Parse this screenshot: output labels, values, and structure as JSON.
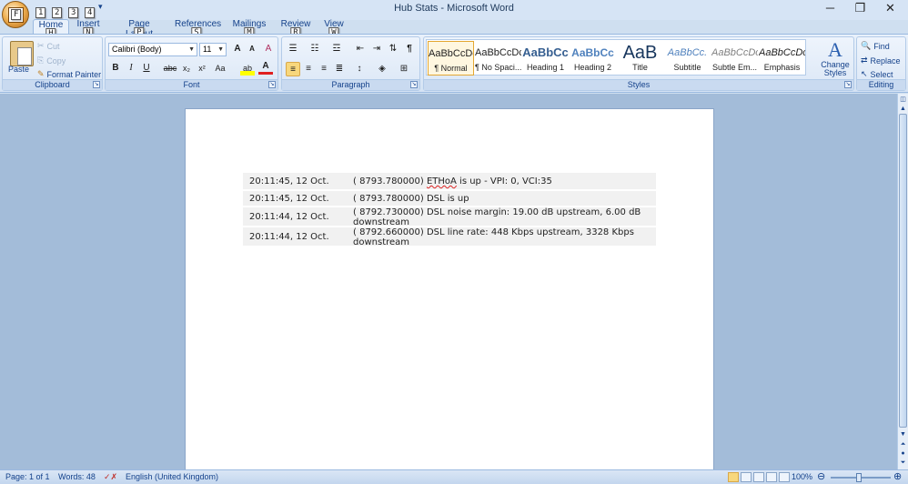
{
  "window": {
    "title": "Hub Stats - Microsoft Word",
    "minimize": "─",
    "restore": "❐",
    "close": "✕"
  },
  "office_button": {
    "glyph": "W",
    "keytip": "F"
  },
  "qat": [
    {
      "name": "save-icon",
      "keytip": "1"
    },
    {
      "name": "undo-icon",
      "keytip": "2"
    },
    {
      "name": "redo-icon",
      "keytip": "3"
    },
    {
      "name": "print-icon",
      "keytip": "4"
    }
  ],
  "qat_more": "▾",
  "tabs": [
    {
      "label": "Home",
      "keytip": "H",
      "active": true
    },
    {
      "label": "Insert",
      "keytip": "N"
    },
    {
      "label": "Page Layout",
      "keytip": "P"
    },
    {
      "label": "References",
      "keytip": "S"
    },
    {
      "label": "Mailings",
      "keytip": "M"
    },
    {
      "label": "Review",
      "keytip": "R"
    },
    {
      "label": "View",
      "keytip": "W"
    }
  ],
  "clipboard": {
    "paste": "Paste",
    "cut": "Cut",
    "copy": "Copy",
    "format_painter": "Format Painter",
    "label": "Clipboard"
  },
  "font": {
    "name": "Calibri (Body)",
    "size": "11",
    "label": "Font",
    "bold": "B",
    "italic": "I",
    "underline": "U",
    "strike": "abc",
    "subscript": "x₂",
    "superscript": "x²",
    "change_case": "Aa",
    "grow": "A",
    "shrink": "A",
    "clear": "A",
    "highlight": "ab",
    "font_color": "A"
  },
  "paragraph": {
    "label": "Paragraph",
    "show_marks": "¶"
  },
  "styles": {
    "label": "Styles",
    "items": [
      {
        "preview": "AaBbCcDc",
        "label": "¶ Normal",
        "selected": true
      },
      {
        "preview": "AaBbCcDc",
        "label": "¶ No Spaci..."
      },
      {
        "preview": "AaBbCc",
        "label": "Heading 1"
      },
      {
        "preview": "AaBbCc",
        "label": "Heading 2"
      },
      {
        "preview": "AaB",
        "label": "Title"
      },
      {
        "preview": "AaBbCc.",
        "label": "Subtitle"
      },
      {
        "preview": "AaBbCcDc",
        "label": "Subtle Em..."
      },
      {
        "preview": "AaBbCcDc",
        "label": "Emphasis"
      }
    ],
    "change_styles": "Change Styles"
  },
  "editing": {
    "find": "Find",
    "replace": "Replace",
    "select": "Select",
    "label": "Editing"
  },
  "document": {
    "rows": [
      {
        "time": "20:11:45, 12 Oct.",
        "prefix": "( 8793.780000) ",
        "flagged": "ETHoA",
        "message": " is up - VPI: 0, VCI:35"
      },
      {
        "time": "20:11:45, 12 Oct.",
        "prefix": "( 8793.780000) ",
        "flagged": "",
        "message": "DSL is up"
      },
      {
        "time": "20:11:44, 12 Oct.",
        "prefix": "( 8792.730000) ",
        "flagged": "",
        "message": "DSL noise margin: 19.00 dB upstream, 6.00 dB downstream"
      },
      {
        "time": "20:11:44, 12 Oct.",
        "prefix": "( 8792.660000) ",
        "flagged": "",
        "message": "DSL line rate: 448 Kbps upstream, 3328 Kbps downstream"
      }
    ]
  },
  "status": {
    "page": "Page: 1 of 1",
    "words": "Words: 48",
    "language": "English (United Kingdom)",
    "zoom": "100%",
    "zoom_out": "⊖",
    "zoom_in": "⊕"
  },
  "colors": {
    "ribbon": "#d5e3f4",
    "doc_bg": "#a3bcd9",
    "accent": "#15428b",
    "selected_style": "#e4a732"
  }
}
